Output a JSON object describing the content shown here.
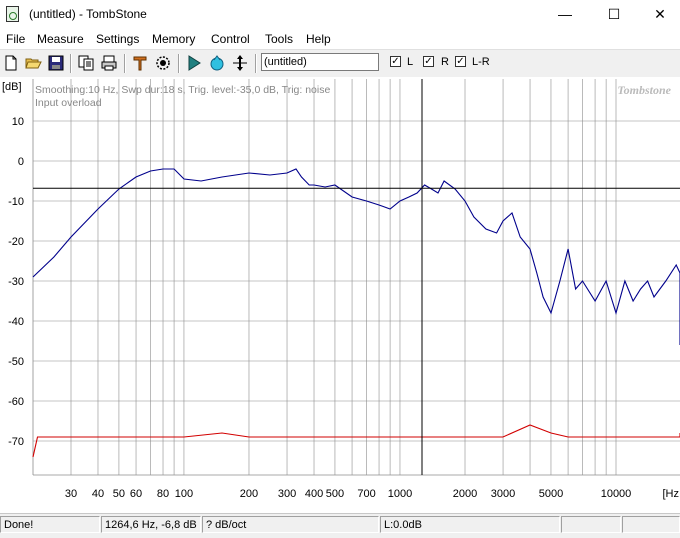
{
  "window": {
    "title": "(untitled) - TombStone",
    "minimize_glyph": "—",
    "maximize_glyph": "☐",
    "close_glyph": "✕"
  },
  "menu": [
    "File",
    "Measure",
    "Settings",
    "Memory",
    "Control",
    "Tools",
    "Help"
  ],
  "toolbar": {
    "icons": [
      "new-file-icon",
      "open-folder-icon",
      "save-disk-icon",
      "copy-icon",
      "print-icon",
      "marker-pin-icon",
      "target-icon",
      "play-icon",
      "loop-icon",
      "cursor-move-icon"
    ],
    "name_value": "(untitled)",
    "checkboxes": [
      {
        "label": "L",
        "checked": true
      },
      {
        "label": "R",
        "checked": true
      },
      {
        "label": "L-R",
        "checked": true
      }
    ]
  },
  "plot": {
    "unit_label": "[dB]",
    "info_line": "Smoothing:10 Hz, Swp dur:18 s, Trig. level:-35,0 dB, Trig: noise",
    "overload_text": "Input overload",
    "brand": "Tombstone",
    "x_unit": "[Hz",
    "colors": {
      "curve1": "#00008c",
      "curve2": "#d20000",
      "grid": "#8c8c8c",
      "cursor": "#000000"
    }
  },
  "chart_data": {
    "type": "line",
    "ylabel": "[dB]",
    "xlabel": "[Hz",
    "x_scale": "log",
    "xlim": [
      18,
      30000
    ],
    "ylim": [
      -80,
      15
    ],
    "y_ticks": [
      10,
      0,
      -10,
      -20,
      -30,
      -40,
      -50,
      -60,
      -70
    ],
    "x_ticks": [
      30,
      40,
      50,
      60,
      80,
      100,
      200,
      300,
      400,
      500,
      700,
      1000,
      2000,
      3000,
      5000,
      10000
    ],
    "x_tick_labels": [
      "30",
      "40",
      "50",
      "60",
      "80",
      "100",
      "200",
      "300",
      "400",
      "500",
      "700",
      "1000",
      "2000",
      "3000",
      "5000",
      "10000"
    ],
    "cursor": {
      "x": 1264.6,
      "y": -6.8
    },
    "series": [
      {
        "color": "#00008c",
        "x": [
          20,
          25,
          30,
          40,
          50,
          60,
          70,
          80,
          90,
          100,
          120,
          150,
          200,
          250,
          300,
          330,
          350,
          380,
          400,
          450,
          500,
          600,
          700,
          800,
          900,
          1000,
          1100,
          1200,
          1300,
          1400,
          1500,
          1600,
          1800,
          2000,
          2200,
          2500,
          2800,
          3000,
          3300,
          3600,
          4000,
          4300,
          4600,
          5000,
          5500,
          6000,
          6500,
          7000,
          8000,
          9000,
          10000,
          11000,
          12000,
          13000,
          14000,
          15000,
          17000,
          19000,
          21000,
          23000,
          25000
        ],
        "y": [
          -29,
          -24,
          -19,
          -12,
          -7,
          -4,
          -2.5,
          -2,
          -2,
          -4.5,
          -5,
          -4,
          -3,
          -3.5,
          -3,
          -2,
          -4,
          -6,
          -6,
          -6.5,
          -6,
          -9,
          -10,
          -11,
          -12,
          -10,
          -9,
          -8,
          -6,
          -7,
          -8,
          -5,
          -7,
          -10,
          -14,
          -17,
          -18,
          -15,
          -13,
          -19,
          -22,
          -28,
          -34,
          -38,
          -30,
          -22,
          -32,
          -30,
          -35,
          -30,
          -38,
          -30,
          -35,
          -32,
          -30,
          -34,
          -30,
          -26,
          -28,
          -38,
          -46
        ]
      },
      {
        "color": "#d20000",
        "x": [
          19,
          20,
          21,
          23,
          26,
          30,
          40,
          60,
          100,
          150,
          200,
          300,
          500,
          1000,
          2000,
          3000,
          4000,
          5000,
          6000,
          8000,
          10000,
          15000,
          20000,
          25000
        ],
        "y": [
          -74,
          -74,
          -69,
          -69,
          -69,
          -69,
          -69,
          -69,
          -69,
          -68,
          -69,
          -69,
          -69,
          -69,
          -69,
          -69,
          -66,
          -68,
          -69,
          -69,
          -69,
          -69,
          -69,
          -68
        ]
      }
    ]
  },
  "status": {
    "message": "Done!",
    "cursor_readout": "1264,6 Hz, -6,8 dB",
    "slope": "? dB/oct",
    "level": "L:0.0dB",
    "empty1": "",
    "empty2": ""
  }
}
